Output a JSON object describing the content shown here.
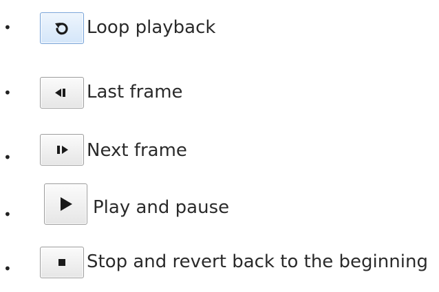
{
  "items": [
    {
      "icon": "loop-icon",
      "label": "Loop playback"
    },
    {
      "icon": "last-frame-icon",
      "label": "Last frame"
    },
    {
      "icon": "next-frame-icon",
      "label": "Next frame"
    },
    {
      "icon": "play-pause-icon",
      "label": "Play and pause"
    },
    {
      "icon": "stop-icon",
      "label": "Stop and revert back to the beginning"
    }
  ],
  "colors": {
    "icon_fill": "#1a1a1a",
    "loop_border": "#6f9ed6"
  }
}
